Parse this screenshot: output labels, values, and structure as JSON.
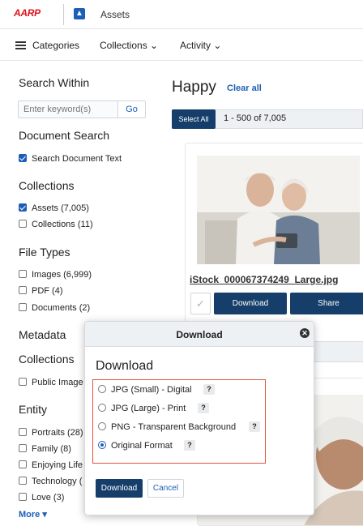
{
  "header": {
    "logo_text": "AARP",
    "app_icon": "app-logo-icon",
    "app_title": "Assets"
  },
  "nav": {
    "categories": "Categories",
    "collections": "Collections",
    "activity": "Activity"
  },
  "sidebar": {
    "search_within": "Search Within",
    "keyword_placeholder": "Enter keyword(s)",
    "go": "Go",
    "document_search": "Document Search",
    "search_doc_text": "Search Document Text",
    "collections_title": "Collections",
    "assets": "Assets (7,005)",
    "collections_item": "Collections (11)",
    "file_types": "File Types",
    "images": "Images (6,999)",
    "pdf": "PDF (4)",
    "documents": "Documents (2)",
    "metadata": "Metadata",
    "collections2": "Collections",
    "public_image": "Public Image",
    "entity": "Entity",
    "portraits": "Portraits (28)",
    "family": "Family (8)",
    "enjoying_life": "Enjoying Life",
    "technology": "Technology (",
    "love": "Love (3)",
    "more": "More ▾"
  },
  "main": {
    "query": "Happy",
    "clear_all": "Clear all",
    "select_all": "Select All",
    "range": "1 - 500 of 7,005",
    "filename": "iStock_000067374249_Large.jpg",
    "download": "Download",
    "share": "Share"
  },
  "modal": {
    "title": "Download",
    "heading": "Download",
    "options": [
      {
        "label": "JPG (Small) - Digital",
        "selected": false
      },
      {
        "label": "JPG (Large) - Print",
        "selected": false
      },
      {
        "label": "PNG - Transparent Background",
        "selected": false
      },
      {
        "label": "Original Format",
        "selected": true
      }
    ],
    "help": "?",
    "download_btn": "Download",
    "cancel_btn": "Cancel"
  },
  "colors": {
    "brand_red": "#e1101a",
    "navy": "#163e6a",
    "link_blue": "#1d5fb6",
    "highlight_border": "#e2533c"
  }
}
